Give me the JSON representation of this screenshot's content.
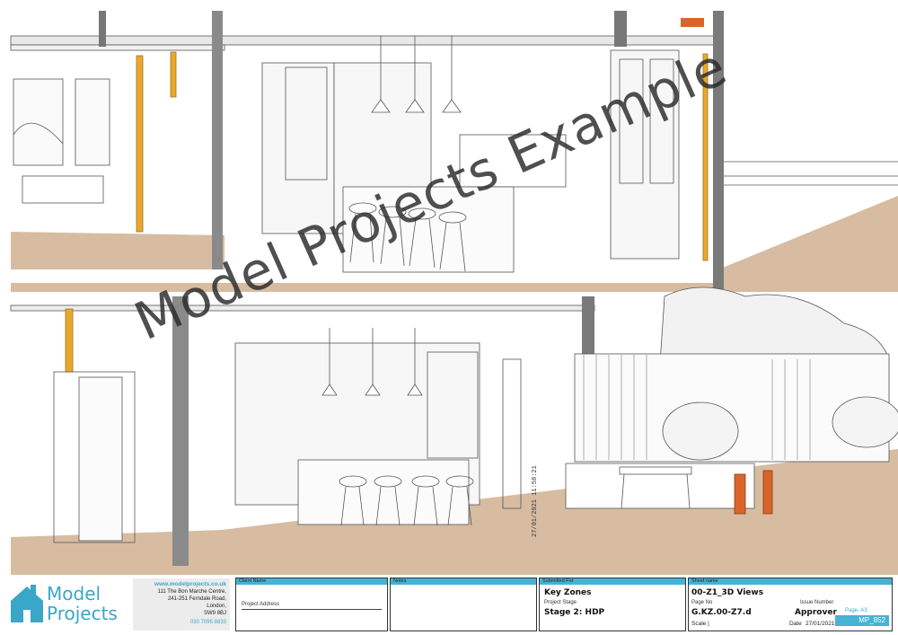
{
  "watermark": "Model Projects Example",
  "print_stamp": "27/01/2021 11:58:21",
  "logo": {
    "line1": "Model",
    "line2": "Projects"
  },
  "contact": {
    "website": "www.modelprojects.co.uk",
    "address": [
      "111 The Bon Marche Centre,",
      "241-251 Ferndale Road,",
      "London,",
      "SW9 8BJ"
    ],
    "phone": "030 7095 8833"
  },
  "client": {
    "header": "Client Name",
    "address_label": "Project Address"
  },
  "notes": {
    "header": "Notes"
  },
  "submitted": {
    "header": "Submitted For",
    "value": "Key Zones",
    "stage_label": "Project Stage",
    "stage_value": "Stage 2: HDP"
  },
  "sheet": {
    "header": "Sheet name",
    "name": "00-Z1_3D Views",
    "page_no_label": "Page No",
    "issue_label": "Issue Number",
    "page_no": "G.KZ.00-Z7.d",
    "approver": "Approver",
    "scale_label": "Scale |",
    "date_label": "Date",
    "date": "27/01/2021",
    "page_size": "Page- A3",
    "badge": "MP_852"
  },
  "colors": {
    "accent": "#45b3d4",
    "ground": "#d9bfa6",
    "timber": "#e8a92a",
    "brick": "#d9652a"
  }
}
